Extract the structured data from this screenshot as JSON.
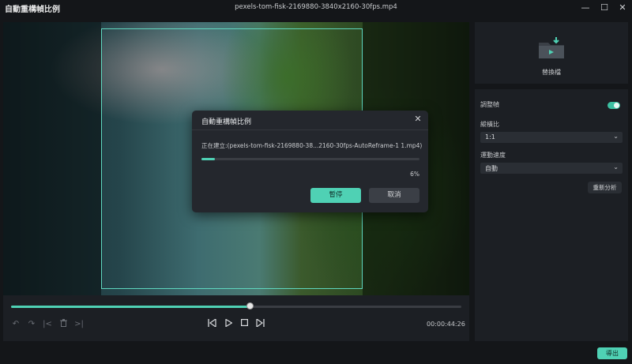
{
  "window": {
    "app_title": "自動重構幀比例",
    "file_title": "pexels-tom-fisk-2169880-3840x2160-30fps.mp4",
    "minimize": "—",
    "maximize": "☐",
    "close": "✕"
  },
  "player": {
    "progress": 0.53,
    "timecode": "00:00:44:26"
  },
  "thumbnail": {
    "replace_label": "替換檔"
  },
  "settings": {
    "adjust_frame_label": "調整幀",
    "adjust_frame_on": true,
    "aspect_ratio_label": "縱橫比",
    "aspect_ratio_value": "1:1",
    "motion_speed_label": "運動速度",
    "motion_speed_value": "自動",
    "reanalyze_label": "重新分析"
  },
  "dialog": {
    "title": "自動重構幀比例",
    "close": "✕",
    "status_text": "正在建立:(pexels-tom-fisk-2169880-38...2160-30fps-AutoReframe-1 1.mp4)",
    "progress": 0.06,
    "percent_text": "6%",
    "pause_label": "暫停",
    "cancel_label": "取消"
  },
  "footer": {
    "export_label": "導出"
  },
  "colors": {
    "accent": "#4fd1b4",
    "background": "#141619",
    "panel": "#1c1f24"
  }
}
